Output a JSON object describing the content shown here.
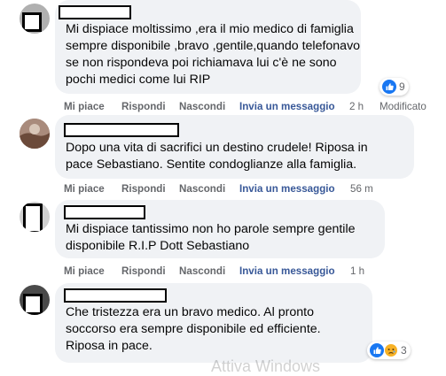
{
  "comments": [
    {
      "text": "Mi dispiace moltissimo ,era il mio medico di famiglia\nsempre disponibile ,bravo ,gentile,quando telefonavo\nse non rispondeva poi richiamava lui c'è ne sono\npochi medici come lui RIP",
      "reaction_count": "9",
      "actions": {
        "like": "Mi piace",
        "reply": "Rispondi",
        "hide": "Nascondi",
        "message": "Invia un messaggio",
        "time": "2 h",
        "edited": "Modificato"
      }
    },
    {
      "text": "Dopo una vita di sacrifici un destino crudele! Riposa in\npace Sebastiano. Sentite condoglianze alla famiglia.",
      "actions": {
        "like": "Mi piace",
        "reply": "Rispondi",
        "hide": "Nascondi",
        "message": "Invia un messaggio",
        "time": "56 m"
      }
    },
    {
      "text": "Mi dispiace tantissimo non ho parole sempre gentile\ndisponibile R.I.P Dott Sebastiano",
      "actions": {
        "like": "Mi piace",
        "reply": "Rispondi",
        "hide": "Nascondi",
        "message": "Invia un messaggio",
        "time": "1 h"
      }
    },
    {
      "text": "Che tristezza era un bravo medico. Al pronto\nsoccorso era sempre disponibile ed efficiente.\nRiposa in pace.",
      "reaction_count": "3"
    }
  ],
  "watermark": "Attiva Windows",
  "colors": {
    "bubble": "#f0f2f5",
    "link": "#385898",
    "muted": "#65676b",
    "like": "#1877f2",
    "sad": "#f7b125"
  },
  "icons": [
    "like-icon",
    "sad-icon"
  ]
}
